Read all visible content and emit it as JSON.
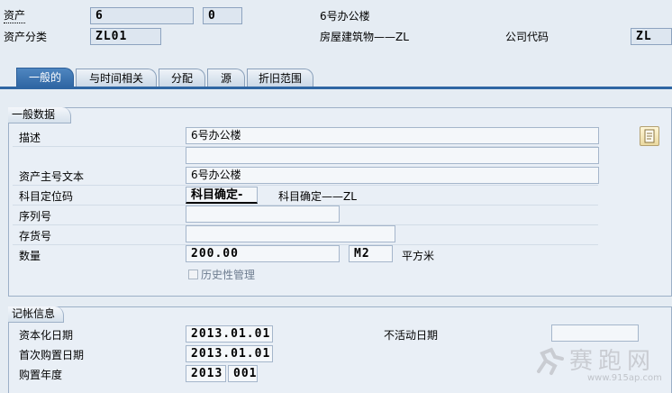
{
  "header": {
    "asset_label": "资产",
    "asset_number": "6",
    "sub_number": "0",
    "asset_desc": "6号办公楼",
    "class_label": "资产分类",
    "class_value": "ZL01",
    "class_desc": "房屋建筑物——ZL",
    "company_label": "公司代码",
    "company_value": "ZL"
  },
  "tabs": [
    {
      "label": "一般的",
      "active": true
    },
    {
      "label": "与时间相关",
      "active": false
    },
    {
      "label": "分配",
      "active": false
    },
    {
      "label": "源",
      "active": false
    },
    {
      "label": "折旧范围",
      "active": false
    }
  ],
  "general": {
    "title": "一般数据",
    "desc_label": "描述",
    "desc_value": "6号办公楼",
    "desc2_value": "",
    "main_text_label": "资产主号文本",
    "main_text_value": "6号办公楼",
    "account_label": "科目定位码",
    "account_value": "科目确定-",
    "account_desc": "科目确定——ZL",
    "serial_label": "序列号",
    "serial_value": "",
    "inventory_label": "存货号",
    "inventory_value": "",
    "qty_label": "数量",
    "qty_value": "200.00",
    "unit_value": "M2",
    "unit_desc": "平方米",
    "history_label": "历史性管理"
  },
  "posting": {
    "title": "记帐信息",
    "cap_date_label": "资本化日期",
    "cap_date_value": "2013.01.01",
    "first_acq_label": "首次购置日期",
    "first_acq_value": "2013.01.01",
    "acq_year_label": "购置年度",
    "acq_year_value": "2013",
    "acq_period_value": "001",
    "inactive_label": "不活动日期",
    "inactive_value": ""
  },
  "watermark": {
    "text": "赛跑网",
    "url": "www.915ap.com"
  },
  "icons": {
    "long_text": "document-icon"
  }
}
